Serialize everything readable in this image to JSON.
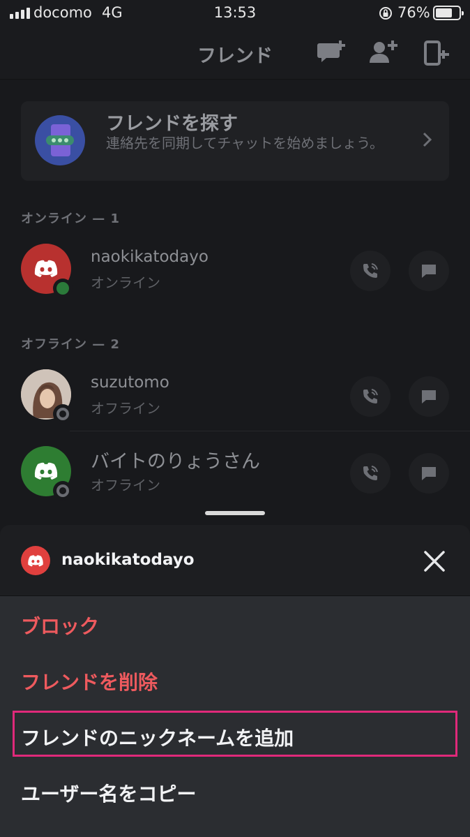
{
  "status_bar": {
    "carrier": "docomo",
    "network": "4G",
    "time": "13:53",
    "battery_percent": "76%",
    "battery_level": 0.76
  },
  "header": {
    "title": "フレンド",
    "icons": [
      "new-group-dm-icon",
      "add-friend-icon",
      "contacts-sync-icon"
    ]
  },
  "find_friends": {
    "title": "フレンドを探す",
    "subtitle": "連絡先を同期してチャットを始めましょう。"
  },
  "sections": {
    "online_header": "オンライン — 1",
    "offline_header": "オフライン — 2"
  },
  "friends": [
    {
      "name": "naokikatodayo",
      "status": "オンライン",
      "avatar": "discord-logo-red",
      "presence": "online"
    },
    {
      "name": "suzutomo",
      "status": "オフライン",
      "avatar": "photo",
      "presence": "offline"
    },
    {
      "name": "バイトのりょうさん",
      "status": "オフライン",
      "avatar": "discord-logo-green",
      "presence": "offline"
    }
  ],
  "sheet": {
    "username": "naokikatodayo",
    "menu": [
      {
        "label": "ブロック",
        "style": "danger"
      },
      {
        "label": "フレンドを削除",
        "style": "danger"
      },
      {
        "label": "フレンドのニックネームを追加",
        "style": "normal",
        "highlighted": true
      },
      {
        "label": "ユーザー名をコピー",
        "style": "normal"
      }
    ]
  },
  "colors": {
    "background": "#18191c",
    "danger": "#ee5a5e",
    "highlight": "#e0297a",
    "online": "#2b7a3a",
    "discord_red": "#b8312f",
    "discord_green": "#2e7d32"
  }
}
